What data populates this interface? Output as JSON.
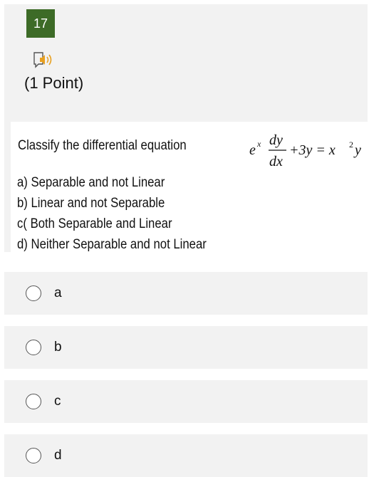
{
  "question": {
    "number": "17",
    "points": "(1 Point)",
    "prompt": "Classify the differential equation",
    "equation": {
      "base": "e",
      "exponent": "x",
      "numerator": "dy",
      "denominator": "dx",
      "middle": "+3y = x",
      "power": "2",
      "tail": "y"
    },
    "options": [
      "a) Separable and not Linear",
      "b) Linear and not Separable",
      "c( Both Separable and Linear",
      "d) Neither Separable and not Linear"
    ]
  },
  "choices": [
    {
      "label": "a"
    },
    {
      "label": "b"
    },
    {
      "label": "c"
    },
    {
      "label": "d"
    }
  ],
  "icons": {
    "speaker": "speaker-icon"
  }
}
